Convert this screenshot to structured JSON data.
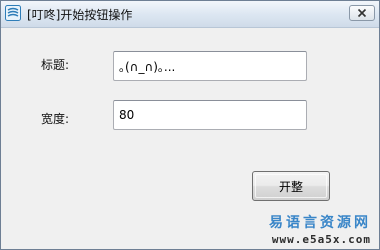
{
  "window": {
    "title": "[叮咚]开始按钮操作",
    "close_symbol": "✕"
  },
  "form": {
    "title_label": "标题:",
    "title_value": "｡(∩_∩)｡...",
    "width_label": "宽度:",
    "width_value": "80",
    "start_button": "开整"
  },
  "watermark": {
    "cn": "易语言资源网",
    "url": "www.e5a5x.com"
  },
  "icons": {
    "app": "app-window-icon",
    "close": "close-icon"
  },
  "colors": {
    "titlebar_top": "#f2f6fb",
    "titlebar_bottom": "#cfdbe9",
    "accent": "#3a86c8",
    "window_bg": "#f0f0f0"
  }
}
